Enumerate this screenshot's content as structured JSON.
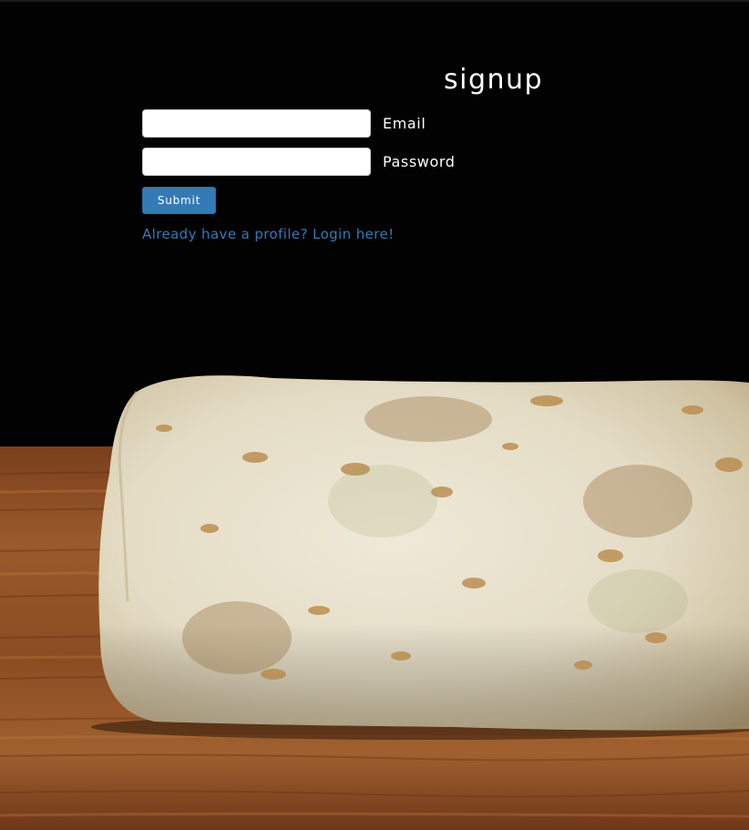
{
  "form": {
    "heading": "signup",
    "email_label": "Email",
    "email_value": "",
    "password_label": "Password",
    "password_value": "",
    "submit_label": "Submit",
    "login_link": "Already have a profile? Login here!"
  },
  "colors": {
    "background": "#030203",
    "accent": "#337ab7",
    "text": "#ffffff"
  },
  "image": {
    "subject": "burrito-on-wooden-table"
  }
}
